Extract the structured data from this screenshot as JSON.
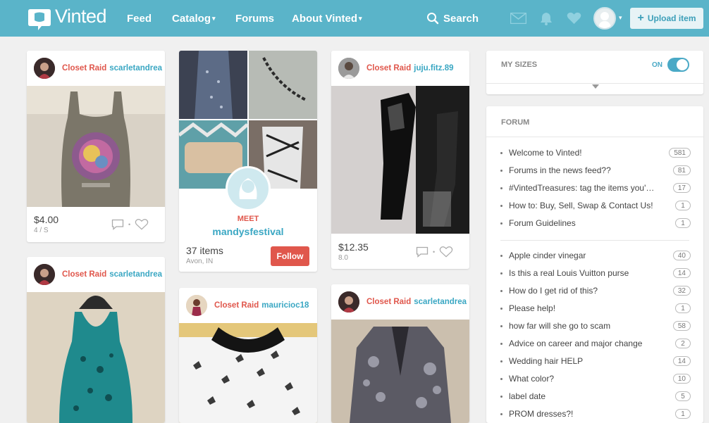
{
  "header": {
    "logo_text": "Vinted",
    "nav": {
      "feed": "Feed",
      "catalog": "Catalog",
      "forums": "Forums",
      "about": "About Vinted"
    },
    "search_label": "Search",
    "upload_label": "Upload item",
    "icons": [
      "mail-icon",
      "bell-icon",
      "heart-icon",
      "avatar"
    ]
  },
  "feed": {
    "c1": {
      "tag": "Closet Raid",
      "user": "scarletandrea",
      "price": "$4.00",
      "size": "4 / S"
    },
    "c2": {
      "tag": "Closet Raid",
      "user": "scarletandrea"
    },
    "c3": {
      "meet": "MEET",
      "user": "mandysfestival",
      "items": "37 items",
      "location": "Avon, IN",
      "follow": "Follow"
    },
    "c4": {
      "tag": "Closet Raid",
      "user": "mauricioc18"
    },
    "c5": {
      "tag": "Closet Raid",
      "user": "juju.fitz.89",
      "price": "$12.35",
      "size": "8.0"
    },
    "c6": {
      "tag": "Closet Raid",
      "user": "scarletandrea"
    }
  },
  "sidebar": {
    "my_sizes": {
      "label": "MY SIZES",
      "state": "ON"
    },
    "forum": {
      "label": "FORUM",
      "pinned": [
        {
          "title": "Welcome to Vinted!",
          "count": "581"
        },
        {
          "title": "Forums in the news feed??",
          "count": "81"
        },
        {
          "title": "#VintedTreasures: tag the items you'…",
          "count": "17"
        },
        {
          "title": "How to: Buy, Sell, Swap & Contact Us!",
          "count": "1"
        },
        {
          "title": "Forum Guidelines",
          "count": "1"
        }
      ],
      "topics": [
        {
          "title": "Apple cinder vinegar",
          "count": "40"
        },
        {
          "title": "Is this a real Louis Vuitton purse",
          "count": "14"
        },
        {
          "title": "How do I get rid of this?",
          "count": "32"
        },
        {
          "title": "Please help!",
          "count": "1"
        },
        {
          "title": "how far will she go to scam",
          "count": "58"
        },
        {
          "title": "Advice on career and major change",
          "count": "2"
        },
        {
          "title": "Wedding hair HELP",
          "count": "14"
        },
        {
          "title": "What color?",
          "count": "10"
        },
        {
          "title": "label date",
          "count": "5"
        },
        {
          "title": "PROM dresses?!",
          "count": "1"
        }
      ]
    }
  },
  "colors": {
    "header_bg": "#5ab4c9",
    "closet_raid": "#e0574c",
    "username": "#3aa7c3",
    "follow_bg": "#e0574c",
    "toggle": "#4aa9c6"
  }
}
